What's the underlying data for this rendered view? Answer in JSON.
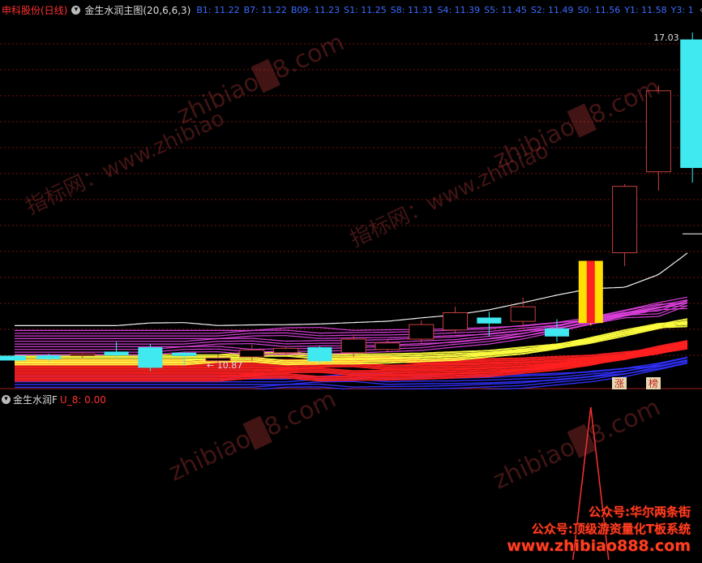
{
  "header": {
    "stock_name": "申科股份(日线)",
    "indicator_name": "金生水润主图(20,6,6,3)",
    "levels": [
      {
        "label": "B1",
        "value": "11.22"
      },
      {
        "label": "B7",
        "value": "11.22"
      },
      {
        "label": "B09",
        "value": "11.23"
      },
      {
        "label": "S1",
        "value": "11.25"
      },
      {
        "label": "S8",
        "value": "11.31"
      },
      {
        "label": "S4",
        "value": "11.39"
      },
      {
        "label": "S5",
        "value": "11.45"
      },
      {
        "label": "S2",
        "value": "11.49"
      },
      {
        "label": "S0",
        "value": "11.56"
      },
      {
        "label": "Y1",
        "value": "11.58"
      },
      {
        "label": "Y3",
        "value": "1"
      }
    ]
  },
  "sub_header": {
    "indicator_name": "金生水润F",
    "value_label": "U_8: 0.00"
  },
  "annotations": {
    "high_label": "17.03",
    "low_label": "← 10.87",
    "zhang_label": "涨",
    "bang_label": "榜"
  },
  "watermarks": {
    "url": "zhibiao",
    "url_suffix": "8.com",
    "cn": "指标网：www.zhibiao"
  },
  "promo": {
    "line1": "公众号:华尔两条街",
    "line2": "公众号:顶级游资量化T板系统",
    "url": "www.zhibiao888.com"
  },
  "colors": {
    "background": "#000000",
    "candle_up": "#c84040",
    "candle_down": "#40e8f0",
    "limit_up_fill": "#ffe000",
    "limit_up_stripe": "#ff2020",
    "ribbon_white": "#ffffff",
    "ribbon_magenta": "#e040e0",
    "ribbon_yellow": "#ffff40",
    "ribbon_red": "#ff2020",
    "ribbon_blue": "#3030ff",
    "sub_line": "#ff3030"
  },
  "chart_data": {
    "type": "candlestick",
    "ylim": [
      10.6,
      17.3
    ],
    "candles": [
      {
        "o": 11.05,
        "c": 10.98,
        "h": 11.08,
        "l": 10.95
      },
      {
        "o": 11.05,
        "c": 11.08,
        "h": 11.12,
        "l": 11.0
      },
      {
        "o": 11.12,
        "c": 11.05,
        "h": 11.3,
        "l": 11.0
      },
      {
        "o": 11.2,
        "c": 10.82,
        "h": 11.26,
        "l": 10.76
      },
      {
        "o": 11.1,
        "c": 11.04,
        "h": 11.12,
        "l": 10.86
      },
      {
        "o": 10.95,
        "c": 11.0,
        "h": 11.06,
        "l": 10.87
      },
      {
        "o": 11.02,
        "c": 11.15,
        "h": 11.25,
        "l": 10.95
      },
      {
        "o": 11.1,
        "c": 11.18,
        "h": 11.22,
        "l": 11.05
      },
      {
        "o": 11.2,
        "c": 10.94,
        "h": 11.22,
        "l": 10.9
      },
      {
        "o": 11.1,
        "c": 11.35,
        "h": 11.43,
        "l": 11.02
      },
      {
        "o": 11.16,
        "c": 11.28,
        "h": 11.33,
        "l": 11.12
      },
      {
        "o": 11.35,
        "c": 11.62,
        "h": 11.7,
        "l": 11.28
      },
      {
        "o": 11.52,
        "c": 11.84,
        "h": 11.95,
        "l": 11.45
      },
      {
        "o": 11.75,
        "c": 11.64,
        "h": 11.86,
        "l": 11.4
      },
      {
        "o": 11.68,
        "c": 11.95,
        "h": 12.12,
        "l": 11.58
      },
      {
        "o": 11.55,
        "c": 11.4,
        "h": 11.72,
        "l": 11.3
      },
      {
        "o": 11.65,
        "c": 12.8,
        "h": 12.8,
        "l": 11.6,
        "limit": true
      },
      {
        "o": 12.95,
        "c": 14.18,
        "h": 14.22,
        "l": 12.7
      },
      {
        "o": 14.45,
        "c": 15.95,
        "h": 16.05,
        "l": 14.1
      },
      {
        "o": 16.9,
        "c": 14.52,
        "h": 17.03,
        "l": 14.25
      }
    ],
    "sub_signal": {
      "x_index": 16,
      "value": 1.0
    },
    "ribbon_layers": {
      "blue": 7,
      "red": 12,
      "yellow": 6,
      "magenta": 10,
      "white": 1
    }
  }
}
